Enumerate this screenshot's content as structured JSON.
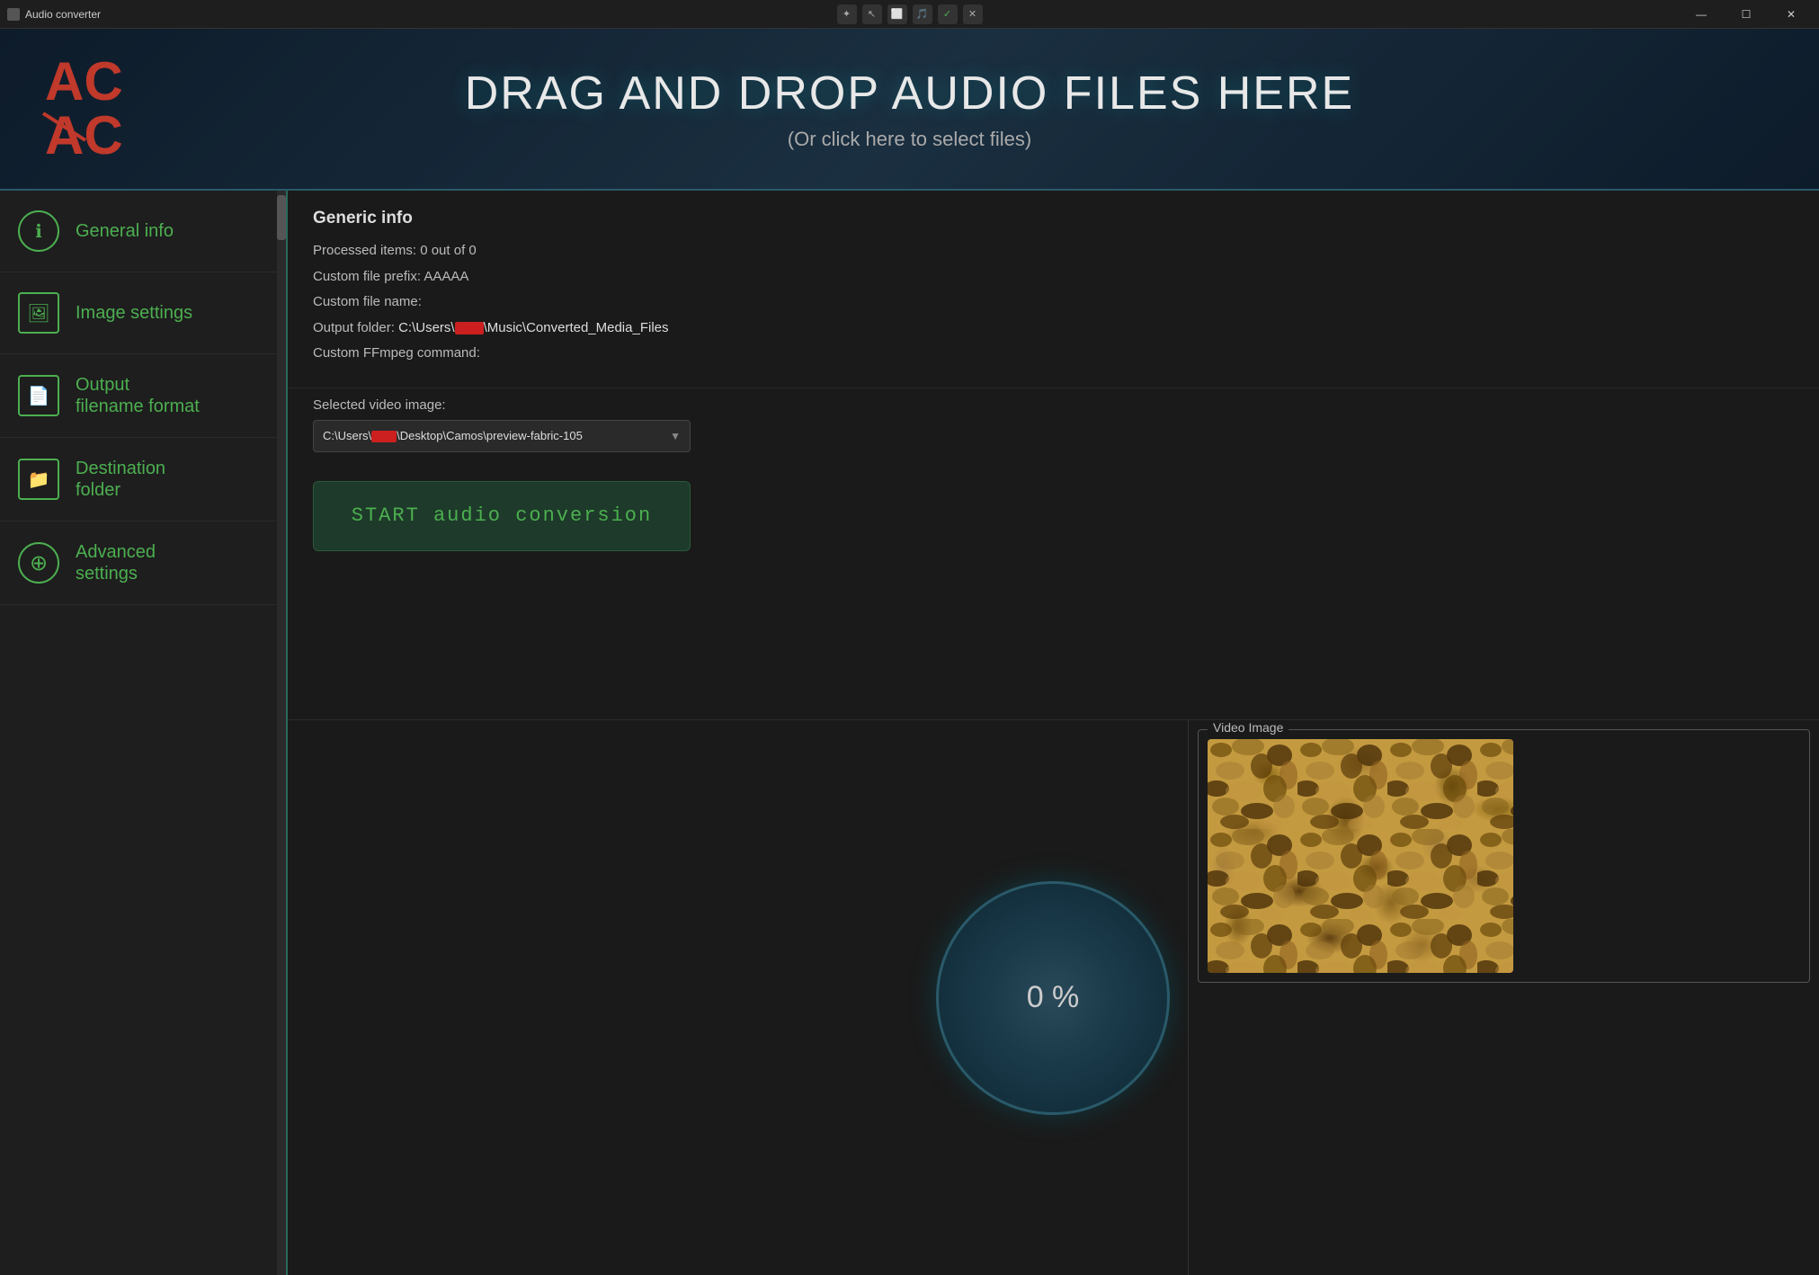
{
  "titlebar": {
    "title": "Audio converter",
    "minimize_label": "—",
    "maximize_label": "☐",
    "close_label": "✕"
  },
  "header": {
    "drag_drop_title": "DRAG AND DROP AUDIO FILES HERE",
    "drag_drop_subtitle": "(Or click here to select files)"
  },
  "sidebar": {
    "items": [
      {
        "id": "general-info",
        "label": "General info",
        "icon": "ℹ"
      },
      {
        "id": "image-settings",
        "label": "Image settings",
        "icon": "🖼"
      },
      {
        "id": "output-filename",
        "label": "Output\nfilename format",
        "icon": "📄"
      },
      {
        "id": "destination-folder",
        "label": "Destination\nfolder",
        "icon": "📁"
      },
      {
        "id": "advanced-settings",
        "label": "Advanced\nsettings",
        "icon": "⊕"
      }
    ],
    "scroll_up": "▲",
    "scroll_down": "▼"
  },
  "generic_info": {
    "section_title": "Generic info",
    "processed_items": "Processed items:  0 out of 0",
    "custom_prefix": "Custom file prefix:  AAAAA",
    "custom_name": "Custom file name:",
    "output_folder": "Output folder:",
    "output_folder_path": "C:\\Users\\████\\Music\\Converted_Media_Files",
    "custom_ffmpeg": "Custom FFmpeg command:",
    "selected_video_image": "Selected video image:",
    "image_path": "C:\\Users\\████\\Desktop\\Camos\\preview-fabric-105",
    "image_dropdown_arrow": "▼"
  },
  "start_button": {
    "label": "START audio conversion"
  },
  "progress": {
    "value": "0 %"
  },
  "video_image": {
    "group_title": "Video Image"
  },
  "colors": {
    "green": "#4CAF50",
    "dark_bg": "#1a1a1a",
    "sidebar_bg": "#1e1e1e",
    "header_bg": "#0d1b2a",
    "border_teal": "#2a6a5a"
  }
}
